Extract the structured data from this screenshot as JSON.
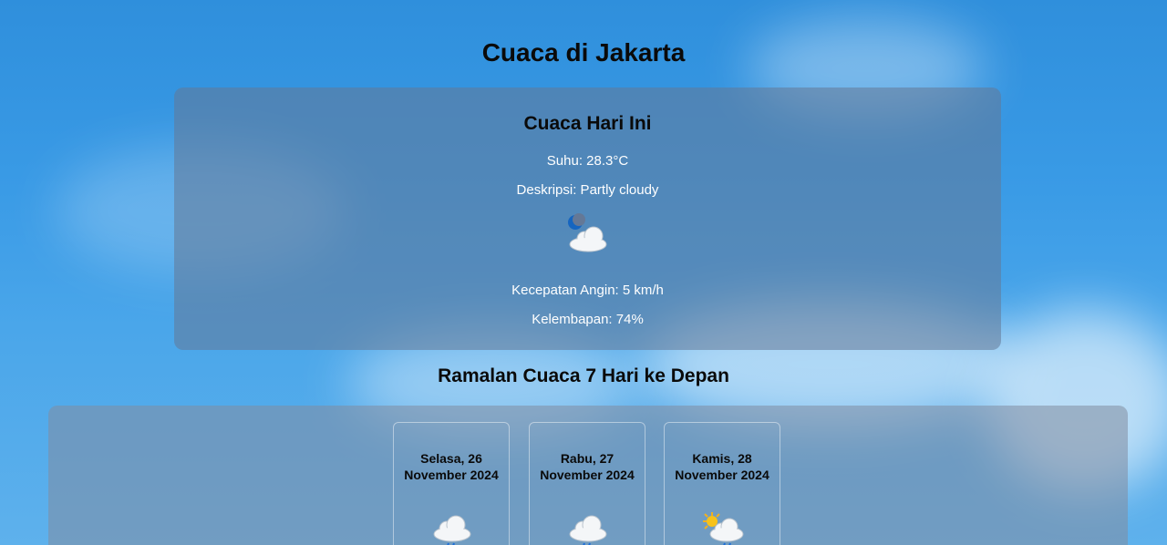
{
  "page": {
    "title": "Cuaca di Jakarta"
  },
  "today": {
    "heading": "Cuaca Hari Ini",
    "temperature": "Suhu: 28.3°C",
    "description": "Deskripsi: Partly cloudy",
    "icon": "night-partly-cloudy-icon",
    "wind": "Kecepatan Angin: 5 km/h",
    "humidity": "Kelembapan: 74%"
  },
  "forecast": {
    "title": "Ramalan Cuaca 7 Hari ke Depan",
    "days": [
      {
        "date": "Selasa, 26 November 2024",
        "icon": "cloud-rain-icon"
      },
      {
        "date": "Rabu, 27 November 2024",
        "icon": "cloud-rain-icon"
      },
      {
        "date": "Kamis, 28 November 2024",
        "icon": "sun-cloud-rain-icon"
      }
    ]
  },
  "colors": {
    "sky": "#3a9be6",
    "text_dark": "#0a0a0a",
    "text_light": "#ffffff"
  }
}
